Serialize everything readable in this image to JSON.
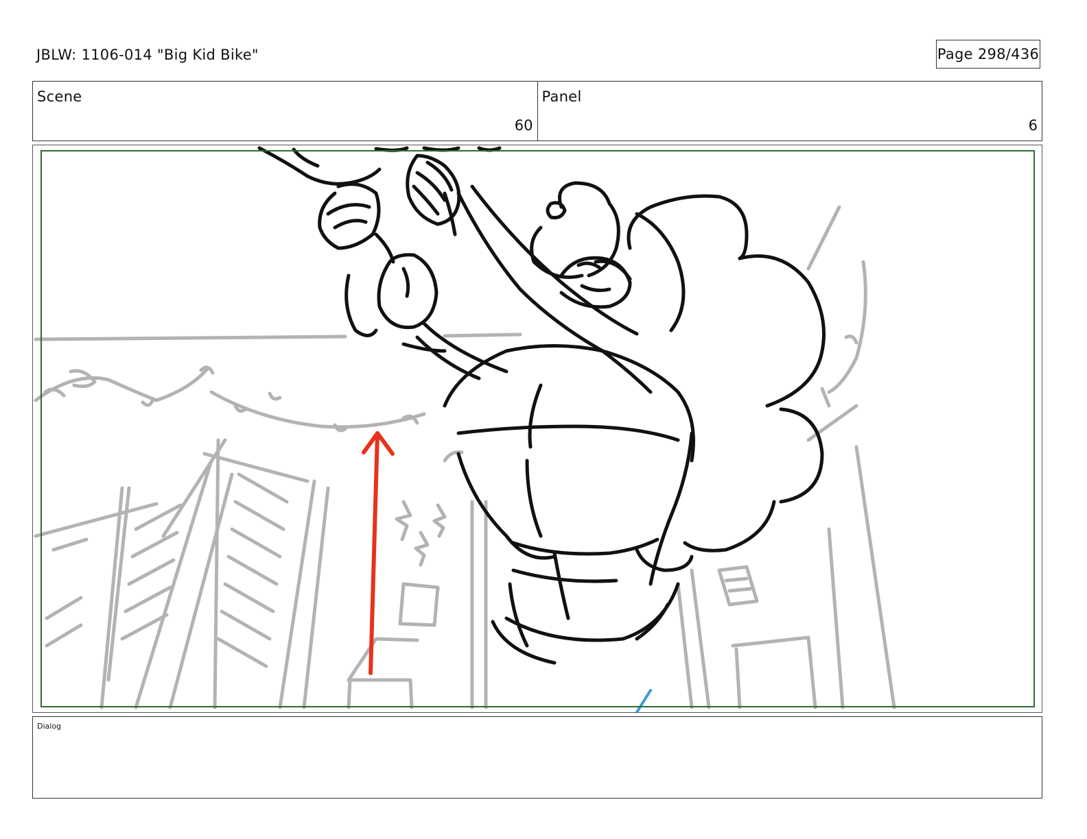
{
  "header": {
    "title": "JBLW: 1106-014 \"Big Kid Bike\"",
    "page_label": "Page 298/436"
  },
  "info": {
    "scene_label": "Scene",
    "scene_value": "60",
    "panel_label": "Panel",
    "panel_value": "6"
  },
  "dialog": {
    "label": "Dialog",
    "text": ""
  },
  "colors": {
    "safe_frame": "#2e6b2e",
    "background_sketch": "#b3b3b3",
    "character_lines": "#111111",
    "camera_arrow": "#e8321a",
    "stray_mark": "#3a9be0"
  }
}
